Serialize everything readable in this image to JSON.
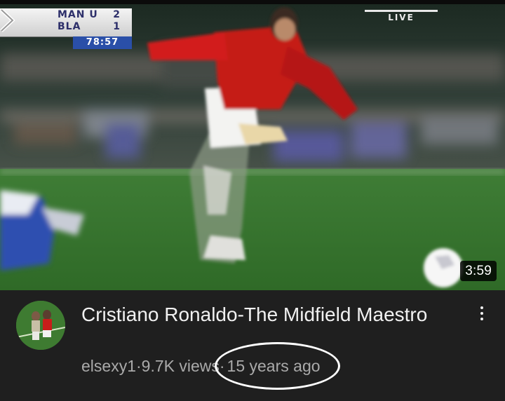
{
  "video": {
    "duration": "3:59",
    "overlay": {
      "score_teams": [
        {
          "team": "MAN U",
          "goals": "2"
        },
        {
          "team": "BLA",
          "goals": "1"
        }
      ],
      "match_clock": "78:57",
      "live_label": "LIVE"
    }
  },
  "details": {
    "title": "Cristiano Ronaldo-The Midfield Maestro",
    "channel": "elsexy1",
    "separator": " · ",
    "views": "9.7K views",
    "uploaded": "15 years ago",
    "more_icon": "more-vert-icon"
  },
  "colors": {
    "background": "#1f1f1f",
    "title_text": "#f1f1f1",
    "meta_text": "#aaaaaa",
    "highlight_ellipse": "#ffffff"
  }
}
